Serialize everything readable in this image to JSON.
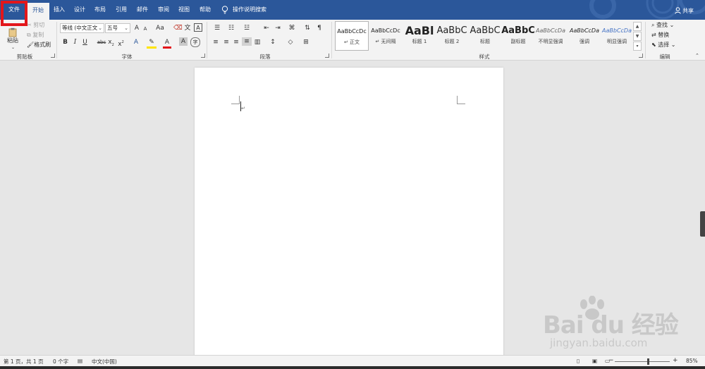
{
  "tabs": [
    {
      "label": "文件"
    },
    {
      "label": "开始"
    },
    {
      "label": "插入"
    },
    {
      "label": "设计"
    },
    {
      "label": "布局"
    },
    {
      "label": "引用"
    },
    {
      "label": "邮件"
    },
    {
      "label": "审阅"
    },
    {
      "label": "视图"
    },
    {
      "label": "帮助"
    }
  ],
  "tell_me": "操作说明搜索",
  "share": "共享",
  "clipboard": {
    "paste": "粘贴",
    "cut": "剪切",
    "copy": "复制",
    "format_painter": "格式刷",
    "label": "剪贴板"
  },
  "font": {
    "family": "等线 (中文正文",
    "size": "五号",
    "grow": "A",
    "shrink": "A",
    "case": "Aa",
    "label": "字体",
    "bold": "B",
    "italic": "I",
    "underline": "U",
    "strike": "abc",
    "sub": "x",
    "sup": "x"
  },
  "paragraph": {
    "label": "段落"
  },
  "styles": {
    "label": "样式",
    "items": [
      {
        "sample": "AaBbCcDc",
        "name": "正文"
      },
      {
        "sample": "AaBbCcDc",
        "name": "无间隔"
      },
      {
        "sample": "AaBl",
        "name": "标题 1"
      },
      {
        "sample": "AaBbC",
        "name": "标题 2"
      },
      {
        "sample": "AaBbC",
        "name": "标题"
      },
      {
        "sample": "AaBbC",
        "name": "副标题"
      },
      {
        "sample": "AaBbCcDa",
        "name": "不明显强调"
      },
      {
        "sample": "AaBbCcDa",
        "name": "强调"
      },
      {
        "sample": "AaBbCcDa",
        "name": "明显强调"
      }
    ]
  },
  "editing": {
    "find": "查找",
    "replace": "替换",
    "select": "选择",
    "label": "编辑"
  },
  "status": {
    "page": "第 1 页，共 1 页",
    "words": "0 个字",
    "language": "中文(中国)",
    "zoom": "85%",
    "zoom_level": 0.6
  },
  "watermark": {
    "brand": "Bai du 经验",
    "url": "jingyan.baidu.com"
  },
  "colors": {
    "accent": "#2b579a",
    "highlight": "#e3161b"
  }
}
